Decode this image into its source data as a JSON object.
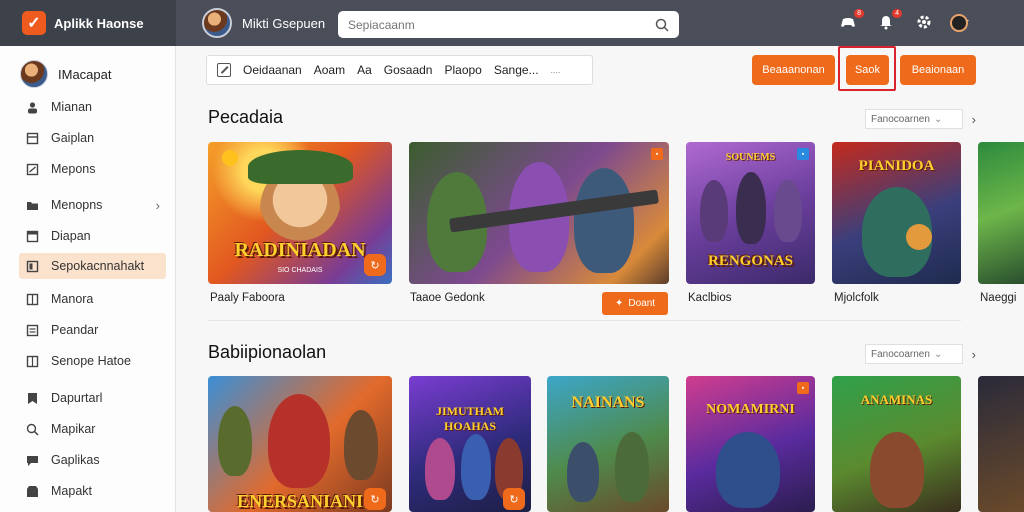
{
  "app": {
    "name": "Aplikk Haonse",
    "user_name": "Mikti Gsepuen"
  },
  "search": {
    "placeholder": "Sepiacaanm"
  },
  "top_icons": {
    "notif1_badge": "8",
    "notif2_badge": "4"
  },
  "sidebar": {
    "user_name": "IMacapat",
    "items": [
      {
        "label": "Mianan",
        "icon": "user-icon"
      },
      {
        "label": "Gaiplan",
        "icon": "book-icon"
      },
      {
        "label": "Mepons",
        "icon": "flag-icon"
      },
      {
        "label": "Menopns",
        "icon": "folder-icon",
        "has_chevron": true
      },
      {
        "label": "Diapan",
        "icon": "box-icon"
      },
      {
        "label": "Sepokacnnahakt",
        "icon": "layout-icon",
        "active": true
      },
      {
        "label": "Manora",
        "icon": "grid-icon"
      },
      {
        "label": "Peandar",
        "icon": "list-icon"
      },
      {
        "label": "Senope Hatoe",
        "icon": "book-icon"
      },
      {
        "label": "Dapurtarl",
        "icon": "bookmark-icon"
      },
      {
        "label": "Mapikar",
        "icon": "search-icon"
      },
      {
        "label": "Gaplikas",
        "icon": "chat-icon"
      },
      {
        "label": "Mapakt",
        "icon": "store-icon"
      }
    ]
  },
  "toolbar": {
    "items": [
      "Oeidaanan",
      "Aoam",
      "Aa",
      "Gosaadn",
      "Plaopo",
      "Sange..."
    ],
    "more": "...."
  },
  "buttons": {
    "left": "Beaaanonan",
    "middle": "Saok",
    "right": "Beaionaan"
  },
  "sections": [
    {
      "title": "Pecadaia",
      "filter": "Fanocoarnen",
      "cards": [
        {
          "label": "Paaly Faboora",
          "overlay": "RADINIADAN",
          "sub": "SIO CHADAIS"
        },
        {
          "label": "Taaoe Gedonk",
          "button": "Doant"
        },
        {
          "label": "Kaclbios",
          "overlay": "RENGONAS",
          "top_overlay": "SOUNEMS"
        },
        {
          "label": "Mjolcfolk",
          "overlay": "PIANIDOA"
        },
        {
          "label": "Naeggi"
        }
      ]
    },
    {
      "title": "Babiipionaolan",
      "filter": "Fanocoarnen",
      "cards": [
        {
          "overlay": "ENERSANIANI"
        },
        {
          "overlay": "JIMUTHAM HOAHAS"
        },
        {
          "overlay": "NAINANS"
        },
        {
          "overlay": "NOMAMIRNI"
        },
        {
          "overlay": "ANAMINAS"
        },
        {
          "overlay": ""
        }
      ]
    }
  ]
}
